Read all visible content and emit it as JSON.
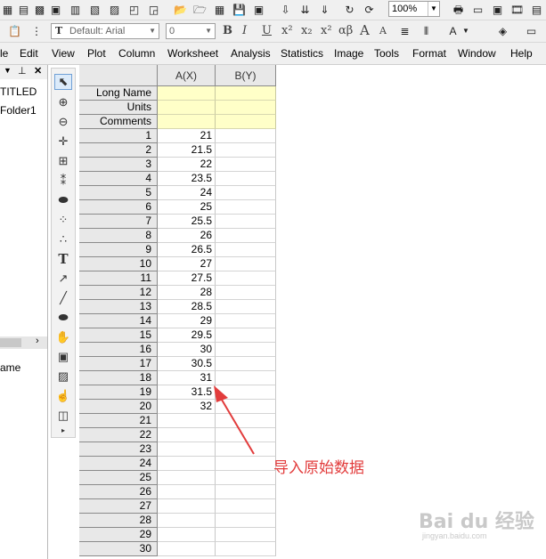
{
  "toolbar": {
    "zoom_value": "100%",
    "font_name_placeholder": "Default: Arial",
    "font_size_value": "0",
    "format_buttons": [
      "B",
      "I",
      "U",
      "x²",
      "x₂",
      "x²",
      "αβ",
      "A",
      "A"
    ]
  },
  "menu": {
    "items": [
      "le",
      "Edit",
      "View",
      "Plot",
      "Column",
      "Worksheet",
      "Analysis",
      "Statistics",
      "Image",
      "Tools",
      "Format",
      "Window",
      "Help"
    ]
  },
  "explorer": {
    "project_title": "TITLED",
    "folder_name": "Folder1",
    "bottom_label": "ame"
  },
  "worksheet": {
    "columns": [
      {
        "label": "A(X)"
      },
      {
        "label": "B(Y)"
      }
    ],
    "meta_rows": [
      "Long Name",
      "Units",
      "Comments"
    ],
    "rows": [
      {
        "n": "1",
        "a": "21",
        "b": ""
      },
      {
        "n": "2",
        "a": "21.5",
        "b": ""
      },
      {
        "n": "3",
        "a": "22",
        "b": ""
      },
      {
        "n": "4",
        "a": "23.5",
        "b": ""
      },
      {
        "n": "5",
        "a": "24",
        "b": ""
      },
      {
        "n": "6",
        "a": "25",
        "b": ""
      },
      {
        "n": "7",
        "a": "25.5",
        "b": ""
      },
      {
        "n": "8",
        "a": "26",
        "b": ""
      },
      {
        "n": "9",
        "a": "26.5",
        "b": ""
      },
      {
        "n": "10",
        "a": "27",
        "b": ""
      },
      {
        "n": "11",
        "a": "27.5",
        "b": ""
      },
      {
        "n": "12",
        "a": "28",
        "b": ""
      },
      {
        "n": "13",
        "a": "28.5",
        "b": ""
      },
      {
        "n": "14",
        "a": "29",
        "b": ""
      },
      {
        "n": "15",
        "a": "29.5",
        "b": ""
      },
      {
        "n": "16",
        "a": "30",
        "b": ""
      },
      {
        "n": "17",
        "a": "30.5",
        "b": ""
      },
      {
        "n": "18",
        "a": "31",
        "b": ""
      },
      {
        "n": "19",
        "a": "31.5",
        "b": ""
      },
      {
        "n": "20",
        "a": "32",
        "b": ""
      },
      {
        "n": "21",
        "a": "",
        "b": ""
      },
      {
        "n": "22",
        "a": "",
        "b": ""
      },
      {
        "n": "23",
        "a": "",
        "b": ""
      },
      {
        "n": "24",
        "a": "",
        "b": ""
      },
      {
        "n": "25",
        "a": "",
        "b": ""
      },
      {
        "n": "26",
        "a": "",
        "b": ""
      },
      {
        "n": "27",
        "a": "",
        "b": ""
      },
      {
        "n": "28",
        "a": "",
        "b": ""
      },
      {
        "n": "29",
        "a": "",
        "b": ""
      },
      {
        "n": "30",
        "a": "",
        "b": ""
      }
    ]
  },
  "annotation": {
    "text": "导入原始数据",
    "color": "#e23c3c"
  },
  "watermark": {
    "main": "Bai du 经验",
    "sub": "jingyan.baidu.com"
  },
  "colors": {
    "meta_row_bg": "#ffffc8",
    "header_bg": "#e8e8e8",
    "active_tool_bg": "#dcebfa"
  }
}
